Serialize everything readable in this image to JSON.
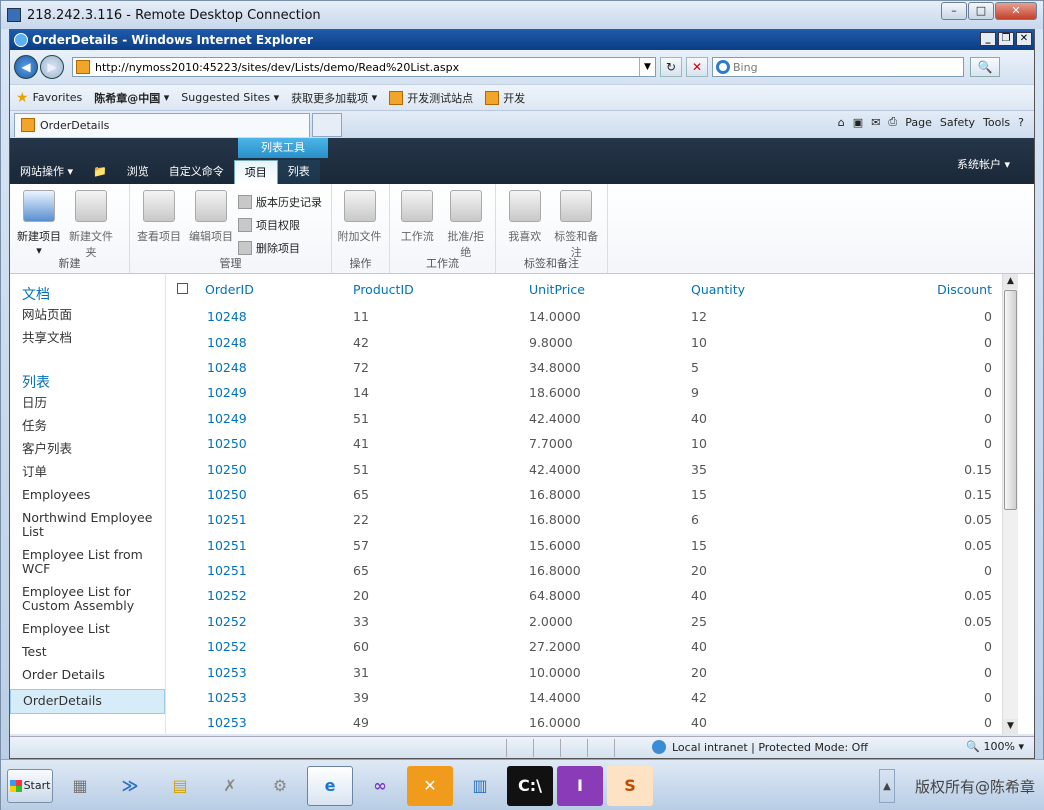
{
  "rdp": {
    "title": "218.242.3.116 - Remote Desktop Connection"
  },
  "ie": {
    "title": "OrderDetails - Windows Internet Explorer",
    "address": "http://nymoss2010:45223/sites/dev/Lists/demo/Read%20List.aspx",
    "search_placeholder": "Bing",
    "favorites": [
      "Favorites",
      "陈希章@中国",
      "Suggested Sites",
      "获取更多加载项",
      "开发测试站点",
      "开发"
    ],
    "tab": "OrderDetails",
    "cmd": [
      "Page",
      "Safety",
      "Tools"
    ]
  },
  "sp": {
    "site_actions": "网站操作",
    "tabs": [
      "浏览",
      "自定义命令",
      "项目",
      "列表"
    ],
    "ctx_label": "列表工具",
    "user": "系统帐户",
    "ribbon": {
      "new": {
        "items": [
          "新建项目",
          "新建文件夹"
        ],
        "group": "新建"
      },
      "manage": {
        "items": [
          "查看项目",
          "编辑项目"
        ],
        "small": [
          "版本历史记录",
          "项目权限",
          "删除项目"
        ],
        "group": "管理"
      },
      "actions": {
        "items": [
          "附加文件"
        ],
        "group": "操作"
      },
      "workflow": {
        "items": [
          "工作流",
          "批准/拒绝"
        ],
        "group": "工作流"
      },
      "tags": {
        "items": [
          "我喜欢",
          "标签和备注"
        ],
        "group": "标签和备注"
      }
    },
    "nav": {
      "docs_header": "文档",
      "docs": [
        "网站页面",
        "共享文档"
      ],
      "lists_header": "列表",
      "lists": [
        "日历",
        "任务",
        "客户列表",
        "订单",
        "Employees",
        "Northwind Employee List",
        "Employee List from WCF",
        "Employee List for Custom Assembly",
        "Employee List",
        "Test",
        "Order Details",
        "OrderDetails"
      ]
    },
    "columns": [
      "OrderID",
      "ProductID",
      "UnitPrice",
      "Quantity",
      "Discount"
    ],
    "rows": [
      [
        "10248",
        "11",
        "14.0000",
        "12",
        "0"
      ],
      [
        "10248",
        "42",
        "9.8000",
        "10",
        "0"
      ],
      [
        "10248",
        "72",
        "34.8000",
        "5",
        "0"
      ],
      [
        "10249",
        "14",
        "18.6000",
        "9",
        "0"
      ],
      [
        "10249",
        "51",
        "42.4000",
        "40",
        "0"
      ],
      [
        "10250",
        "41",
        "7.7000",
        "10",
        "0"
      ],
      [
        "10250",
        "51",
        "42.4000",
        "35",
        "0.15"
      ],
      [
        "10250",
        "65",
        "16.8000",
        "15",
        "0.15"
      ],
      [
        "10251",
        "22",
        "16.8000",
        "6",
        "0.05"
      ],
      [
        "10251",
        "57",
        "15.6000",
        "15",
        "0.05"
      ],
      [
        "10251",
        "65",
        "16.8000",
        "20",
        "0"
      ],
      [
        "10252",
        "20",
        "64.8000",
        "40",
        "0.05"
      ],
      [
        "10252",
        "33",
        "2.0000",
        "25",
        "0.05"
      ],
      [
        "10252",
        "60",
        "27.2000",
        "40",
        "0"
      ],
      [
        "10253",
        "31",
        "10.0000",
        "20",
        "0"
      ],
      [
        "10253",
        "39",
        "14.4000",
        "42",
        "0"
      ],
      [
        "10253",
        "49",
        "16.0000",
        "40",
        "0"
      ]
    ]
  },
  "status": {
    "zone": "Local intranet | Protected Mode: Off",
    "zoom": "100%"
  },
  "taskbar": {
    "start": "Start",
    "watermark": "版权所有@陈希章"
  }
}
